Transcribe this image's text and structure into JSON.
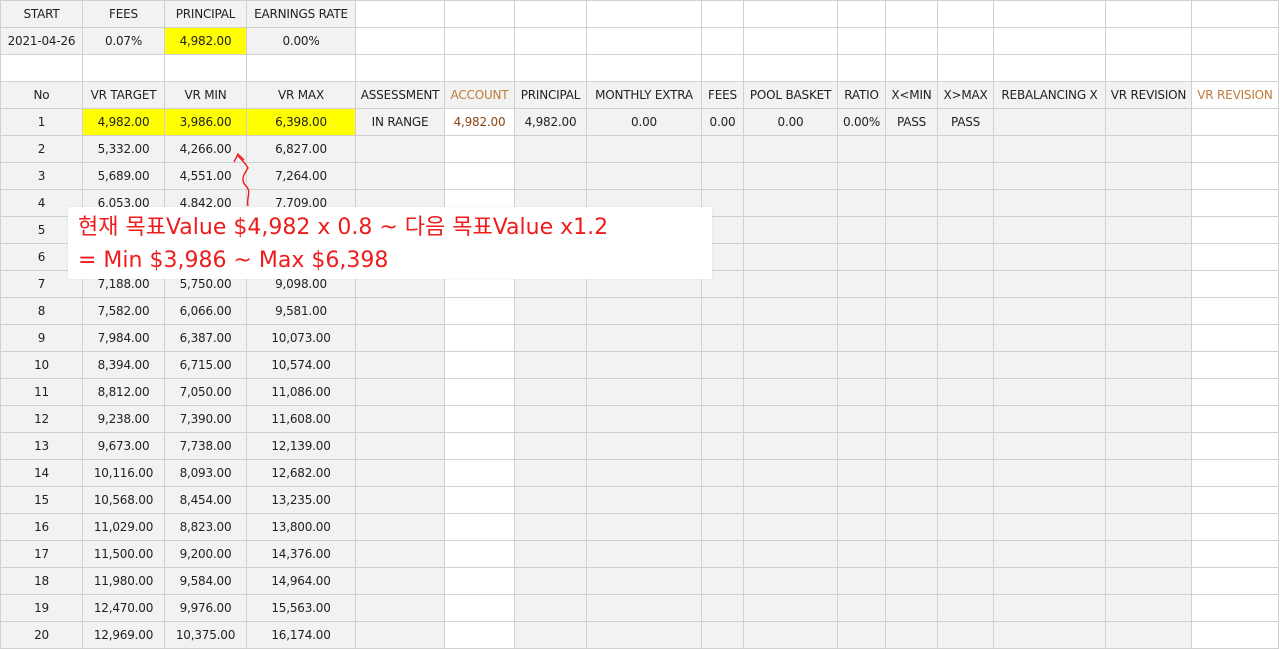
{
  "top": {
    "headers": [
      "START",
      "FEES",
      "PRINCIPAL",
      "EARNINGS RATE"
    ],
    "values": [
      "2021-04-26",
      "0.07%",
      "4,982.00",
      "0.00%"
    ]
  },
  "main": {
    "headers": [
      "No",
      "VR TARGET",
      "VR MIN",
      "VR MAX",
      "ASSESSMENT",
      "ACCOUNT",
      "PRINCIPAL",
      "MONTHLY EXTRA",
      "FEES",
      "POOL BASKET",
      "RATIO",
      "X<MIN",
      "X>MAX",
      "REBALANCING X",
      "VR REVISION",
      "VR REVISION"
    ],
    "first_row_extra": {
      "assessment": "IN RANGE",
      "account": "4,982.00",
      "principal": "4,982.00",
      "monthly_extra": "0.00",
      "fees": "0.00",
      "pool_basket": "0.00",
      "ratio": "0.00%",
      "x_min": "PASS",
      "x_max": "PASS"
    },
    "rows": [
      {
        "no": "1",
        "target": "4,982.00",
        "min": "3,986.00",
        "max": "6,398.00"
      },
      {
        "no": "2",
        "target": "5,332.00",
        "min": "4,266.00",
        "max": "6,827.00"
      },
      {
        "no": "3",
        "target": "5,689.00",
        "min": "4,551.00",
        "max": "7,264.00"
      },
      {
        "no": "4",
        "target": "6,053.00",
        "min": "4,842.00",
        "max": "7,709.00"
      },
      {
        "no": "5",
        "target": "",
        "min": "",
        "max": ""
      },
      {
        "no": "6",
        "target": "",
        "min": "",
        "max": ""
      },
      {
        "no": "7",
        "target": "7,188.00",
        "min": "5,750.00",
        "max": "9,098.00"
      },
      {
        "no": "8",
        "target": "7,582.00",
        "min": "6,066.00",
        "max": "9,581.00"
      },
      {
        "no": "9",
        "target": "7,984.00",
        "min": "6,387.00",
        "max": "10,073.00"
      },
      {
        "no": "10",
        "target": "8,394.00",
        "min": "6,715.00",
        "max": "10,574.00"
      },
      {
        "no": "11",
        "target": "8,812.00",
        "min": "7,050.00",
        "max": "11,086.00"
      },
      {
        "no": "12",
        "target": "9,238.00",
        "min": "7,390.00",
        "max": "11,608.00"
      },
      {
        "no": "13",
        "target": "9,673.00",
        "min": "7,738.00",
        "max": "12,139.00"
      },
      {
        "no": "14",
        "target": "10,116.00",
        "min": "8,093.00",
        "max": "12,682.00"
      },
      {
        "no": "15",
        "target": "10,568.00",
        "min": "8,454.00",
        "max": "13,235.00"
      },
      {
        "no": "16",
        "target": "11,029.00",
        "min": "8,823.00",
        "max": "13,800.00"
      },
      {
        "no": "17",
        "target": "11,500.00",
        "min": "9,200.00",
        "max": "14,376.00"
      },
      {
        "no": "18",
        "target": "11,980.00",
        "min": "9,584.00",
        "max": "14,964.00"
      },
      {
        "no": "19",
        "target": "12,470.00",
        "min": "9,976.00",
        "max": "15,563.00"
      },
      {
        "no": "20",
        "target": "12,969.00",
        "min": "10,375.00",
        "max": "16,174.00"
      }
    ]
  },
  "annotation": {
    "line1": "현재 목표Value $4,982 x 0.8 ~ 다음 목표Value x1.2",
    "line2": "= Min $3,986 ~ Max $6,398"
  },
  "colors": {
    "highlight": "#ffff00",
    "annotation": "#ee1c1c",
    "account_text": "#8b4513",
    "cell_gray": "#f2f2f2"
  }
}
